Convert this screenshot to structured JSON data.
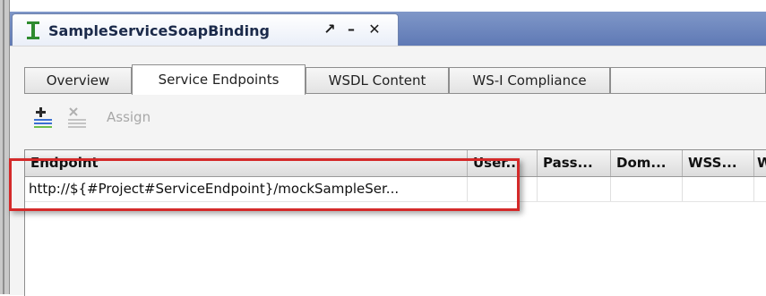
{
  "window": {
    "title": "SampleServiceSoapBinding",
    "icon": "soap-interface-icon",
    "controls": {
      "restore": "↗",
      "minimize": "–",
      "close": "✕"
    }
  },
  "tabs": [
    {
      "label": "Overview",
      "active": false
    },
    {
      "label": "Service Endpoints",
      "active": true
    },
    {
      "label": "WSDL Content",
      "active": false
    },
    {
      "label": "WS-I Compliance",
      "active": false
    }
  ],
  "toolbar": {
    "add_icon": "add-endpoint-icon",
    "delete_icon": "delete-endpoint-icon",
    "assign_label": "Assign"
  },
  "table": {
    "columns": [
      "Endpoint",
      "User...",
      "Pass...",
      "Dom...",
      "WSS...",
      "W"
    ],
    "rows": [
      [
        "http://${#Project#ServiceEndpoint}/mockSampleSer...",
        "",
        "",
        "",
        "",
        ""
      ]
    ]
  },
  "colors": {
    "accent": "#5f79b5",
    "highlight": "#d42a2a"
  }
}
